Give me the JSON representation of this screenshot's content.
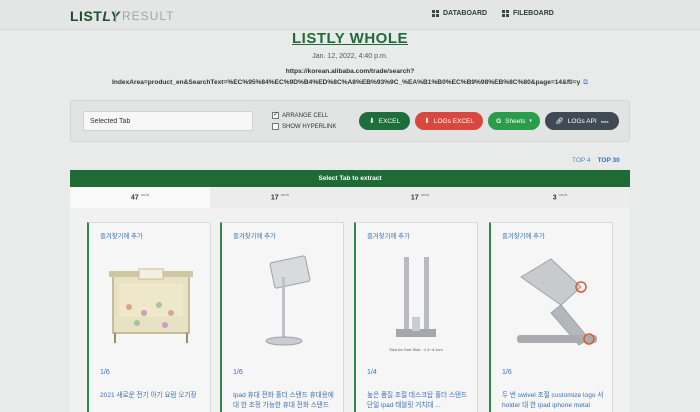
{
  "header": {
    "logo_main": "LIST",
    "logo_italic": "LY",
    "logo_separator": "|",
    "logo_sub": "RESULT",
    "nav": [
      {
        "label": "DATABOARD",
        "icon": "grid-icon"
      },
      {
        "label": "FILEBOARD",
        "icon": "grid-icon"
      }
    ]
  },
  "page": {
    "title": "LISTLY WHOLE",
    "date": "Jan. 12, 2022, 4:40 p.m.",
    "url": "https://korean.alibaba.com/trade/search?IndexArea=product_en&SearchText=%EC%95%84%EC%9D%B4%ED%8C%A8%EB%93%9C_%EA%B1%B0%EC%B9%98%EB%8C%80&page=14&f0=y"
  },
  "panel": {
    "tab_input_value": "Selected Tab",
    "arrange_cell_label": "ARRANGE CELL",
    "arrange_cell_checked": true,
    "show_hyperlink_label": "SHOW HYPERLINK",
    "show_hyperlink_checked": false,
    "buttons": {
      "excel": "EXCEL",
      "logs_excel": "LOGs EXCEL",
      "sheets": "Sheets",
      "logs_api": "LOGs API",
      "logs_api_badge": "beta"
    },
    "colors": {
      "excel": "#1d6e3a",
      "logs_excel": "#d9483f",
      "sheets": "#2a9d4a",
      "logs_api": "#3f4a55"
    }
  },
  "top_links": {
    "top4": "TOP 4",
    "top30": "TOP 30"
  },
  "tabbar_label": "Select Tab to extract",
  "tabs": [
    {
      "count": "47",
      "unit": "cards"
    },
    {
      "count": "17",
      "unit": "cards"
    },
    {
      "count": "17",
      "unit": "cards"
    },
    {
      "count": "3",
      "unit": "cards"
    }
  ],
  "cards": [
    {
      "fav": "즐겨찾기에 추가",
      "count": "1/6",
      "title": "2021 새로운 전기 아기 요람 오기장",
      "image": "baby-crib-image"
    },
    {
      "fav": "즐겨찾기에 추가",
      "count": "1/6",
      "title": "Ipad 휴대 전화 홀더 스탠드 휴대용에 대 한 조정 가능한 휴대 전화 스탠드",
      "image": "tablet-stand-image"
    },
    {
      "fav": "즐겨찾기에 추가",
      "count": "1/4",
      "title": "높은 품질 조절 데스크탑 홀더 스탠드 단일 ipad 태블릿 거치대 ...",
      "image": "dual-stand-image"
    },
    {
      "fav": "즐겨찾기에 추가",
      "count": "1/6",
      "title": "두 번 swivel 조절 customize logo 서 holder 대 한 ipad iphone metal",
      "image": "foldable-stand-image"
    }
  ],
  "card3_caption": "Size for One Side : 1.4~4.1cm"
}
